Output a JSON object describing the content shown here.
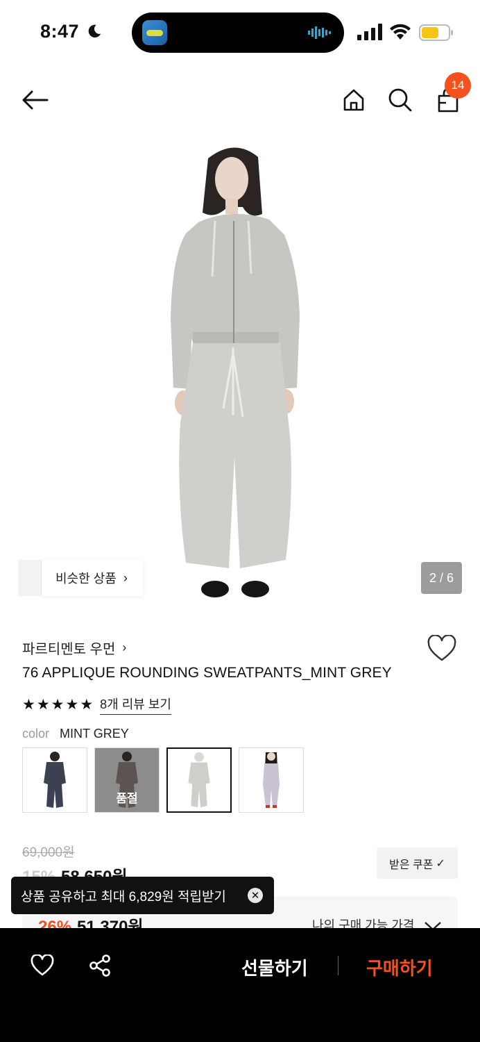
{
  "status": {
    "time": "8:47"
  },
  "nav": {
    "cart_count": "14"
  },
  "hero": {
    "similar_label": "비슷한 상품",
    "pager": "2 / 6"
  },
  "product": {
    "brand": "파르티멘토 우먼",
    "name": "76 APPLIQUE ROUNDING SWEATPANTS_MINT GREY",
    "rating_stars": 5,
    "review_link": "8개 리뷰 보기",
    "color_key": "color",
    "color_value": "MINT GREY",
    "swatches": [
      {
        "color": "navy",
        "soldout": ""
      },
      {
        "color": "charcoal",
        "soldout": "품절"
      },
      {
        "color": "mint grey",
        "soldout": ""
      },
      {
        "color": "lavender",
        "soldout": ""
      }
    ]
  },
  "price": {
    "original": "69,000원",
    "discount_pct": "15%",
    "discounted": "58,650원",
    "coupon_button": "받은 쿠폰",
    "best_pct": "26%",
    "best_price": "51,370원",
    "my_best_label": "나의 구매 가능 가격"
  },
  "toast": {
    "text": "상품 공유하고 최대 6,829원 적립받기"
  },
  "bottom": {
    "gift_label": "선물하기",
    "buy_label": "구매하기"
  },
  "colors": {
    "accent": "#f4511e",
    "bar": "#000000"
  }
}
